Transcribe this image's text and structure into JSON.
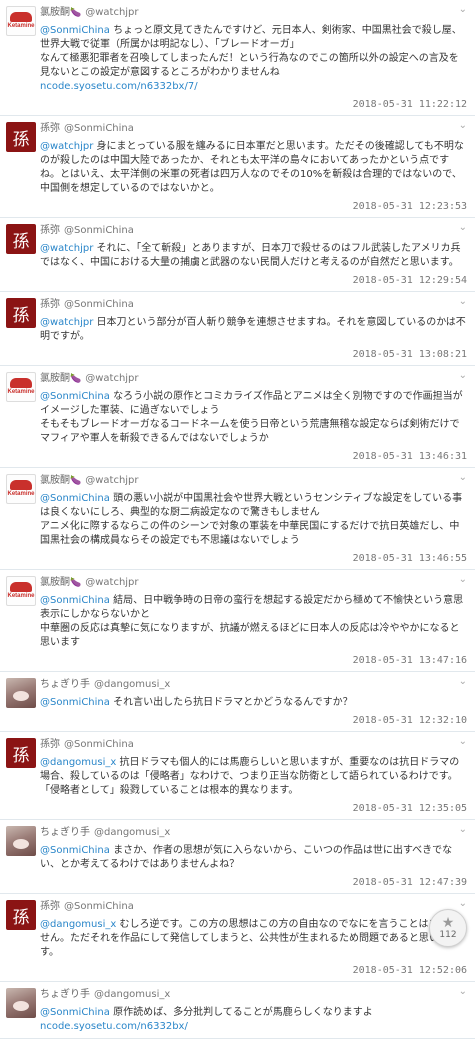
{
  "tweets": [
    {
      "avatar": "ketamine",
      "avatar_text": [
        "",
        "Ketamine"
      ],
      "name": "氯胺酮",
      "emoji": "🍆",
      "handle": "@watchjpr",
      "mention": "@SonmiChina",
      "text": " ちょっと原文見てきたんですけど、元日本人、剣術家、中国黒社会で殺し屋、世界大戦で従軍（所属かは明記なし）、「ブレードオーガ」\nなんて極悪犯罪者を召喚してしまったんだ！という行為なのでこの箇所以外の設定への言及を見ないとこの設定が意図するところがわかりませんね",
      "link": "ncode.syosetu.com/n6332bx/7/",
      "time": "2018-05-31 11:22:12"
    },
    {
      "avatar": "sun",
      "avatar_text": "孫",
      "name": "孫弥",
      "emoji": "",
      "handle": "@SonmiChina",
      "mention": "@watchjpr",
      "text": " 身にまとっている服を纏みるに日本軍だと思います。ただその後確認しても不明なのが殺したのは中国大陸であったか、それとも太平洋の島々においてあったかという点ですね。とはいえ、太平洋側の米軍の死者は四万人なのでその10%を斬殺は合理的ではないので、中国側を想定しているのではないかと。",
      "link": "",
      "time": "2018-05-31 12:23:53"
    },
    {
      "avatar": "sun",
      "avatar_text": "孫",
      "name": "孫弥",
      "emoji": "",
      "handle": "@SonmiChina",
      "mention": "@watchjpr",
      "text": " それに、「全て斬殺」とありますが、日本刀で殺せるのはフル武装したアメリカ兵ではなく、中国における大量の捕虜と武器のない民間人だけと考えるのが自然だと思います。",
      "link": "",
      "time": "2018-05-31 12:29:54"
    },
    {
      "avatar": "sun",
      "avatar_text": "孫",
      "name": "孫弥",
      "emoji": "",
      "handle": "@SonmiChina",
      "mention": "@watchjpr",
      "text": " 日本刀という部分が百人斬り競争を連想させますね。それを意図しているのかは不明ですが。",
      "link": "",
      "time": "2018-05-31 13:08:21"
    },
    {
      "avatar": "ketamine",
      "avatar_text": [
        "",
        "Ketamine"
      ],
      "name": "氯胺酮",
      "emoji": "🍆",
      "handle": "@watchjpr",
      "mention": "@SonmiChina",
      "text": " なろう小説の原作とコミカライズ作品とアニメは全く別物ですので作画担当がイメージした軍装、に過ぎないでしょう\nそもそもブレードオーガなるコードネームを使う日帝という荒唐無稽な設定ならば剣術だけでマフィアや軍人を斬殺できるんではないでしょうか",
      "link": "",
      "time": "2018-05-31 13:46:31"
    },
    {
      "avatar": "ketamine",
      "avatar_text": [
        "",
        "Ketamine"
      ],
      "name": "氯胺酮",
      "emoji": "🍆",
      "handle": "@watchjpr",
      "mention": "@SonmiChina",
      "text": " 頭の悪い小説が中国黒社会や世界大戦というセンシティブな設定をしている事は良くないにしろ、典型的な厨二病設定なので驚きもしません\nアニメ化に際するならこの件のシーンで対象の軍装を中華民国にするだけで抗日英雄だし、中国黒社会の構成員ならその設定でも不思議はないでしょう",
      "link": "",
      "time": "2018-05-31 13:46:55"
    },
    {
      "avatar": "ketamine",
      "avatar_text": [
        "",
        "Ketamine"
      ],
      "name": "氯胺酮",
      "emoji": "🍆",
      "handle": "@watchjpr",
      "mention": "@SonmiChina",
      "text": " 結局、日中戦争時の日帝の蛮行を想起する設定だから極めて不愉快という意思表示にしかならないかと\n中華圏の反応は真摯に気になりますが、抗議が燃えるほどに日本人の反応は冷ややかになると思います",
      "link": "",
      "time": "2018-05-31 13:47:16"
    },
    {
      "avatar": "dango",
      "avatar_text": "",
      "name": "ちょぎり手",
      "emoji": "",
      "handle": "@dangomusi_x",
      "mention": "@SonmiChina",
      "text": " それ言い出したら抗日ドラマとかどうなるんですか？",
      "link": "",
      "time": "2018-05-31 12:32:10"
    },
    {
      "avatar": "sun",
      "avatar_text": "孫",
      "name": "孫弥",
      "emoji": "",
      "handle": "@SonmiChina",
      "mention": "@dangomusi_x",
      "text": " 抗日ドラマも個人的には馬鹿らしいと思いますが、重要なのは抗日ドラマの場合、殺しているのは「侵略者」なわけで、つまり正当な防衛として語られているわけです。「侵略者として」殺戮していることは根本的異なります。",
      "link": "",
      "time": "2018-05-31 12:35:05"
    },
    {
      "avatar": "dango",
      "avatar_text": "",
      "name": "ちょぎり手",
      "emoji": "",
      "handle": "@dangomusi_x",
      "mention": "@SonmiChina",
      "text": " まさか、作者の思想が気に入らないから、こいつの作品は世に出すべきでない、とか考えてるわけではありませんよね？",
      "link": "",
      "time": "2018-05-31 12:47:39"
    },
    {
      "avatar": "sun",
      "avatar_text": "孫",
      "name": "孫弥",
      "emoji": "",
      "handle": "@SonmiChina",
      "mention": "@dangomusi_x",
      "text": " むしろ逆です。この方の思想はこの方の自由なのでなにを言うことはありません。ただそれを作品にして発信してしまうと、公共性が生まれるため問題であると思います。",
      "link": "",
      "time": "2018-05-31 12:52:06"
    },
    {
      "avatar": "dango",
      "avatar_text": "",
      "name": "ちょぎり手",
      "emoji": "",
      "handle": "@dangomusi_x",
      "mention": "@SonmiChina",
      "text": " 原作読めば、多分批判してることが馬鹿らしくなりますよ",
      "link": "ncode.syosetu.com/n6332bx/",
      "time": ""
    }
  ],
  "favorite_button": {
    "icon": "star-icon",
    "count": "112"
  },
  "colors": {
    "link": "#2a86c9",
    "sun_avatar": "#8b1414",
    "ketamine_red": "#c9302c"
  }
}
